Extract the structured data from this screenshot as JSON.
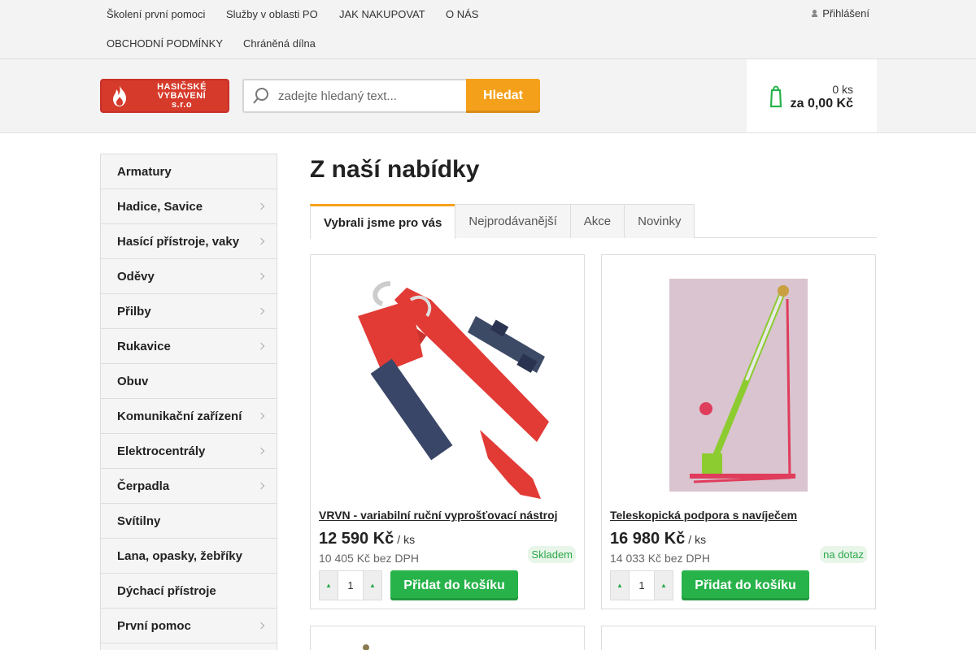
{
  "topnav": {
    "links": [
      "Školení první pomoci",
      "Služby v oblasti PO",
      "JAK NAKUPOVAT",
      "O NÁS",
      "OBCHODNÍ PODMÍNKY",
      "Chráněná dílna"
    ],
    "login": "Přihlášení"
  },
  "header": {
    "logo_lines": [
      "HASIČSKÉ",
      "VYBAVENÍ",
      "s.r.o"
    ],
    "search_placeholder": "zadejte hledaný text...",
    "search_button": "Hledat",
    "cart_qty": "0 ks",
    "cart_total": "za 0,00 Kč"
  },
  "sidebar": {
    "items": [
      {
        "label": "Armatury",
        "has_sub": false
      },
      {
        "label": "Hadice, Savice",
        "has_sub": true
      },
      {
        "label": "Hasící přístroje, vaky",
        "has_sub": true
      },
      {
        "label": "Oděvy",
        "has_sub": true
      },
      {
        "label": "Přilby",
        "has_sub": true
      },
      {
        "label": "Rukavice",
        "has_sub": true
      },
      {
        "label": "Obuv",
        "has_sub": false
      },
      {
        "label": "Komunikační zařízení",
        "has_sub": true
      },
      {
        "label": "Elektrocentrály",
        "has_sub": true
      },
      {
        "label": "Čerpadla",
        "has_sub": true
      },
      {
        "label": "Svítilny",
        "has_sub": false
      },
      {
        "label": "Lana, opasky, žebříky",
        "has_sub": false
      },
      {
        "label": "Dýchací přístroje",
        "has_sub": false
      },
      {
        "label": "První pomoc",
        "has_sub": true
      }
    ]
  },
  "main": {
    "title": "Z naší nabídky",
    "tabs": [
      "Vybrali jsme pro vás",
      "Nejprodávanější",
      "Akce",
      "Novinky"
    ],
    "products": [
      {
        "name": "VRVN - variabilní ruční vyprošťovací nástroj",
        "price": "12 590 Kč",
        "unit": "/ ks",
        "netto": "10 405 Kč bez DPH",
        "availability": "Skladem",
        "qty": "1",
        "add_label": "Přidat do košíku"
      },
      {
        "name": "Teleskopická podpora s navíječem",
        "price": "16 980 Kč",
        "unit": "/ ks",
        "netto": "14 033 Kč bez DPH",
        "availability": "na dotaz",
        "qty": "1",
        "add_label": "Přidat do košíku"
      }
    ]
  },
  "colors": {
    "accent": "#f5a01a",
    "green": "#27b34a",
    "logo_red": "#d63a2a"
  }
}
